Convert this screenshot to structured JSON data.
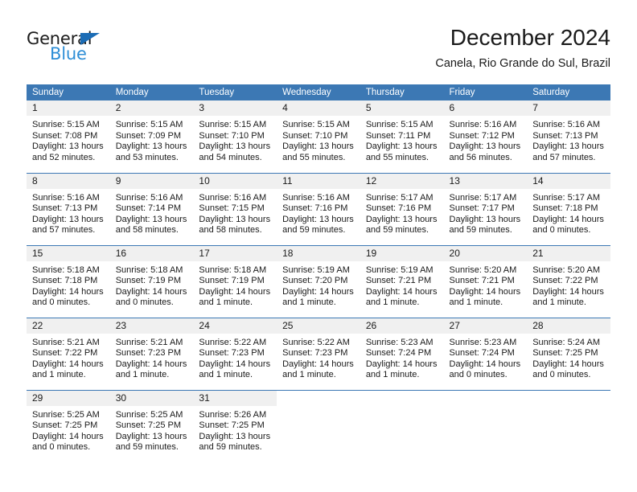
{
  "brand": {
    "name_part1": "General",
    "name_part2": "Blue",
    "triangle_color": "#1b6cb5",
    "blue_color": "#2e8ed6"
  },
  "header": {
    "title": "December 2024",
    "subtitle": "Canela, Rio Grande do Sul, Brazil"
  },
  "theme": {
    "header_blue": "#3c78b4",
    "daynum_band": "#f0f0f0",
    "text": "#1a1a1a"
  },
  "calendar": {
    "weekday_headers": [
      "Sunday",
      "Monday",
      "Tuesday",
      "Wednesday",
      "Thursday",
      "Friday",
      "Saturday"
    ],
    "weeks": [
      [
        {
          "day": "1",
          "sunrise": "Sunrise: 5:15 AM",
          "sunset": "Sunset: 7:08 PM",
          "daylight_line1": "Daylight: 13 hours",
          "daylight_line2": "and 52 minutes."
        },
        {
          "day": "2",
          "sunrise": "Sunrise: 5:15 AM",
          "sunset": "Sunset: 7:09 PM",
          "daylight_line1": "Daylight: 13 hours",
          "daylight_line2": "and 53 minutes."
        },
        {
          "day": "3",
          "sunrise": "Sunrise: 5:15 AM",
          "sunset": "Sunset: 7:10 PM",
          "daylight_line1": "Daylight: 13 hours",
          "daylight_line2": "and 54 minutes."
        },
        {
          "day": "4",
          "sunrise": "Sunrise: 5:15 AM",
          "sunset": "Sunset: 7:10 PM",
          "daylight_line1": "Daylight: 13 hours",
          "daylight_line2": "and 55 minutes."
        },
        {
          "day": "5",
          "sunrise": "Sunrise: 5:15 AM",
          "sunset": "Sunset: 7:11 PM",
          "daylight_line1": "Daylight: 13 hours",
          "daylight_line2": "and 55 minutes."
        },
        {
          "day": "6",
          "sunrise": "Sunrise: 5:16 AM",
          "sunset": "Sunset: 7:12 PM",
          "daylight_line1": "Daylight: 13 hours",
          "daylight_line2": "and 56 minutes."
        },
        {
          "day": "7",
          "sunrise": "Sunrise: 5:16 AM",
          "sunset": "Sunset: 7:13 PM",
          "daylight_line1": "Daylight: 13 hours",
          "daylight_line2": "and 57 minutes."
        }
      ],
      [
        {
          "day": "8",
          "sunrise": "Sunrise: 5:16 AM",
          "sunset": "Sunset: 7:13 PM",
          "daylight_line1": "Daylight: 13 hours",
          "daylight_line2": "and 57 minutes."
        },
        {
          "day": "9",
          "sunrise": "Sunrise: 5:16 AM",
          "sunset": "Sunset: 7:14 PM",
          "daylight_line1": "Daylight: 13 hours",
          "daylight_line2": "and 58 minutes."
        },
        {
          "day": "10",
          "sunrise": "Sunrise: 5:16 AM",
          "sunset": "Sunset: 7:15 PM",
          "daylight_line1": "Daylight: 13 hours",
          "daylight_line2": "and 58 minutes."
        },
        {
          "day": "11",
          "sunrise": "Sunrise: 5:16 AM",
          "sunset": "Sunset: 7:16 PM",
          "daylight_line1": "Daylight: 13 hours",
          "daylight_line2": "and 59 minutes."
        },
        {
          "day": "12",
          "sunrise": "Sunrise: 5:17 AM",
          "sunset": "Sunset: 7:16 PM",
          "daylight_line1": "Daylight: 13 hours",
          "daylight_line2": "and 59 minutes."
        },
        {
          "day": "13",
          "sunrise": "Sunrise: 5:17 AM",
          "sunset": "Sunset: 7:17 PM",
          "daylight_line1": "Daylight: 13 hours",
          "daylight_line2": "and 59 minutes."
        },
        {
          "day": "14",
          "sunrise": "Sunrise: 5:17 AM",
          "sunset": "Sunset: 7:18 PM",
          "daylight_line1": "Daylight: 14 hours",
          "daylight_line2": "and 0 minutes."
        }
      ],
      [
        {
          "day": "15",
          "sunrise": "Sunrise: 5:18 AM",
          "sunset": "Sunset: 7:18 PM",
          "daylight_line1": "Daylight: 14 hours",
          "daylight_line2": "and 0 minutes."
        },
        {
          "day": "16",
          "sunrise": "Sunrise: 5:18 AM",
          "sunset": "Sunset: 7:19 PM",
          "daylight_line1": "Daylight: 14 hours",
          "daylight_line2": "and 0 minutes."
        },
        {
          "day": "17",
          "sunrise": "Sunrise: 5:18 AM",
          "sunset": "Sunset: 7:19 PM",
          "daylight_line1": "Daylight: 14 hours",
          "daylight_line2": "and 1 minute."
        },
        {
          "day": "18",
          "sunrise": "Sunrise: 5:19 AM",
          "sunset": "Sunset: 7:20 PM",
          "daylight_line1": "Daylight: 14 hours",
          "daylight_line2": "and 1 minute."
        },
        {
          "day": "19",
          "sunrise": "Sunrise: 5:19 AM",
          "sunset": "Sunset: 7:21 PM",
          "daylight_line1": "Daylight: 14 hours",
          "daylight_line2": "and 1 minute."
        },
        {
          "day": "20",
          "sunrise": "Sunrise: 5:20 AM",
          "sunset": "Sunset: 7:21 PM",
          "daylight_line1": "Daylight: 14 hours",
          "daylight_line2": "and 1 minute."
        },
        {
          "day": "21",
          "sunrise": "Sunrise: 5:20 AM",
          "sunset": "Sunset: 7:22 PM",
          "daylight_line1": "Daylight: 14 hours",
          "daylight_line2": "and 1 minute."
        }
      ],
      [
        {
          "day": "22",
          "sunrise": "Sunrise: 5:21 AM",
          "sunset": "Sunset: 7:22 PM",
          "daylight_line1": "Daylight: 14 hours",
          "daylight_line2": "and 1 minute."
        },
        {
          "day": "23",
          "sunrise": "Sunrise: 5:21 AM",
          "sunset": "Sunset: 7:23 PM",
          "daylight_line1": "Daylight: 14 hours",
          "daylight_line2": "and 1 minute."
        },
        {
          "day": "24",
          "sunrise": "Sunrise: 5:22 AM",
          "sunset": "Sunset: 7:23 PM",
          "daylight_line1": "Daylight: 14 hours",
          "daylight_line2": "and 1 minute."
        },
        {
          "day": "25",
          "sunrise": "Sunrise: 5:22 AM",
          "sunset": "Sunset: 7:23 PM",
          "daylight_line1": "Daylight: 14 hours",
          "daylight_line2": "and 1 minute."
        },
        {
          "day": "26",
          "sunrise": "Sunrise: 5:23 AM",
          "sunset": "Sunset: 7:24 PM",
          "daylight_line1": "Daylight: 14 hours",
          "daylight_line2": "and 1 minute."
        },
        {
          "day": "27",
          "sunrise": "Sunrise: 5:23 AM",
          "sunset": "Sunset: 7:24 PM",
          "daylight_line1": "Daylight: 14 hours",
          "daylight_line2": "and 0 minutes."
        },
        {
          "day": "28",
          "sunrise": "Sunrise: 5:24 AM",
          "sunset": "Sunset: 7:25 PM",
          "daylight_line1": "Daylight: 14 hours",
          "daylight_line2": "and 0 minutes."
        }
      ],
      [
        {
          "day": "29",
          "sunrise": "Sunrise: 5:25 AM",
          "sunset": "Sunset: 7:25 PM",
          "daylight_line1": "Daylight: 14 hours",
          "daylight_line2": "and 0 minutes."
        },
        {
          "day": "30",
          "sunrise": "Sunrise: 5:25 AM",
          "sunset": "Sunset: 7:25 PM",
          "daylight_line1": "Daylight: 13 hours",
          "daylight_line2": "and 59 minutes."
        },
        {
          "day": "31",
          "sunrise": "Sunrise: 5:26 AM",
          "sunset": "Sunset: 7:25 PM",
          "daylight_line1": "Daylight: 13 hours",
          "daylight_line2": "and 59 minutes."
        },
        {
          "day": "",
          "sunrise": "",
          "sunset": "",
          "daylight_line1": "",
          "daylight_line2": ""
        },
        {
          "day": "",
          "sunrise": "",
          "sunset": "",
          "daylight_line1": "",
          "daylight_line2": ""
        },
        {
          "day": "",
          "sunrise": "",
          "sunset": "",
          "daylight_line1": "",
          "daylight_line2": ""
        },
        {
          "day": "",
          "sunrise": "",
          "sunset": "",
          "daylight_line1": "",
          "daylight_line2": ""
        }
      ]
    ]
  }
}
